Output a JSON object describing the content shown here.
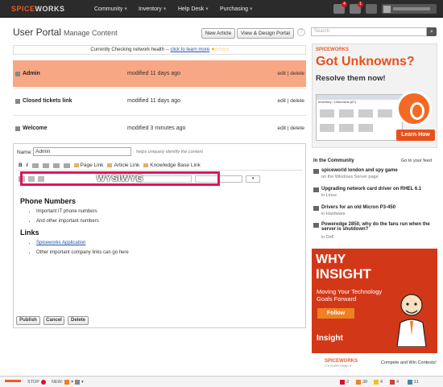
{
  "header": {
    "logo_main": "SPICE",
    "logo_accent": "WORKS",
    "nav": [
      "Community",
      "Inventory",
      "Help Desk",
      "Purchasing"
    ],
    "alert_count": "4",
    "ticket_count": "1",
    "cart_icon": "cart-icon"
  },
  "page": {
    "title": "User Portal",
    "subtitle": "Manage Content",
    "new_article": "New Article",
    "view_design": "View & Design Portal",
    "help": "?"
  },
  "health": {
    "text": "Currently Checking network health --",
    "link": "click to learn more",
    "stars": "★☆☆☆☆"
  },
  "rows": [
    {
      "name": "Admin",
      "modified": "modified 11 days ago",
      "actions": "edit | delete"
    },
    {
      "name": "Closed tickets link",
      "modified": "modified 11 days ago",
      "actions": "edit | delete"
    },
    {
      "name": "Welcome",
      "modified": "modified 3 minutes ago",
      "actions": "edit | delete"
    }
  ],
  "editor": {
    "name_label": "Name:",
    "name_value": "Admin",
    "name_hint": "helps uniquely identify the content",
    "bold": "B",
    "italic": "I",
    "page_link": "Page Link",
    "article_link": "Article Link",
    "kb_link": "Knowledge Base Link",
    "wysiwyg": "WYSIWYG",
    "h_phone": "Phone Numbers",
    "phone_items": [
      "Important IT phone numbers",
      "And other important numbers"
    ],
    "h_links": "Links",
    "link_item": "Spiceworks Application",
    "link_other": "Other important company links can go here",
    "publish": "Publish",
    "cancel": "Cancel",
    "delete": "Delete"
  },
  "sidebar": {
    "search_placeholder": "Search",
    "ad1": {
      "logo": "SPICEWORKS",
      "headline": "Got Unknowns?",
      "sub": "Resolve them now!",
      "shot_caption": "Inventory › Unknowns (67)",
      "cta": "Learn How"
    },
    "community_title": "In the Community",
    "community_link": "Go to your feed",
    "community": [
      {
        "title": "spiceworld london and spy game",
        "src": "on the Windows Server page"
      },
      {
        "title": "Upgrading network card driver on RHEL 6.1",
        "src": "in Linux"
      },
      {
        "title": "Drivers for an old Micron P3-450",
        "src": "in Hardware"
      },
      {
        "title": "Poweredge 2850, why do the fans run when the server is shutdown?",
        "src": "in Dell"
      }
    ],
    "ad2": {
      "why": "WHY",
      "insight": "INSIGHT",
      "sub": "Moving Your Technology Goals Forward",
      "follow": "Follow",
      "brand": "Insight"
    },
    "footer_ad": {
      "logo": "SPICEWORKS",
      "tag": "IT'S EVERYTHING IT",
      "text": "Compete and Win Contests!"
    }
  },
  "statusbar": {
    "stop": "STOP",
    "new": "NEW:",
    "c1": "2",
    "c2": "38",
    "c3": "4",
    "c4": "4",
    "c5": "11"
  }
}
